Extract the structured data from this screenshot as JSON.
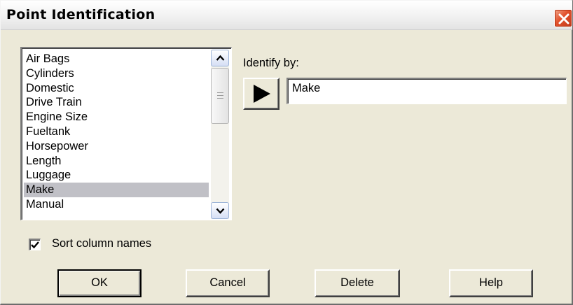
{
  "window": {
    "title": "Point Identification"
  },
  "columns": {
    "items": [
      "Air Bags",
      "Cylinders",
      "Domestic",
      "Drive Train",
      "Engine Size",
      "Fueltank",
      "Horsepower",
      "Length",
      "Luggage",
      "Make",
      "Manual"
    ],
    "selected": "Make"
  },
  "identify": {
    "label": "Identify by:",
    "value": "Make"
  },
  "sort": {
    "label": "Sort column names",
    "checked": true
  },
  "buttons": {
    "ok": "OK",
    "cancel": "Cancel",
    "delete": "Delete",
    "help": "Help"
  },
  "icons": {
    "close": "close-icon",
    "scroll_up": "chevron-up-icon",
    "scroll_down": "chevron-down-icon",
    "add": "play-arrow-icon",
    "check": "checkmark-icon"
  },
  "colors": {
    "close_button": "#e2512c",
    "selection": "#c0c0c6",
    "dialog_bg": "#ece9d8"
  }
}
